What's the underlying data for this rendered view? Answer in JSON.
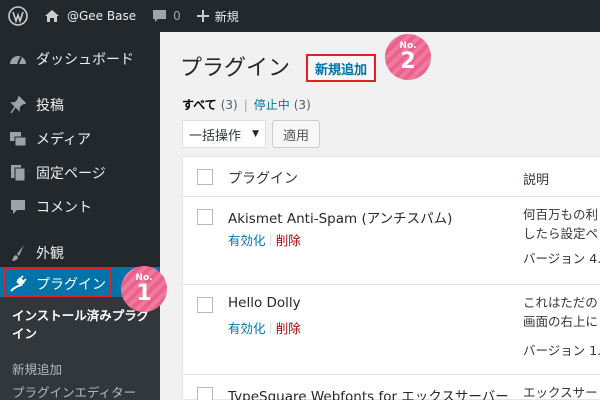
{
  "admin_bar": {
    "site_name": "@Gee Base",
    "comment_count": "0",
    "new_label": "新規"
  },
  "sidebar": {
    "items": [
      {
        "label": "ダッシュボード",
        "icon": "dashboard-icon"
      },
      {
        "label": "投稿",
        "icon": "pin-icon"
      },
      {
        "label": "メディア",
        "icon": "media-icon"
      },
      {
        "label": "固定ページ",
        "icon": "page-icon"
      },
      {
        "label": "コメント",
        "icon": "comment-icon"
      },
      {
        "label": "外観",
        "icon": "brush-icon"
      },
      {
        "label": "プラグイン",
        "icon": "plugin-icon"
      }
    ],
    "submenu": [
      {
        "label": "インストール済みプラグイン"
      },
      {
        "label": "新規追加"
      },
      {
        "label": "プラグインエディター"
      }
    ]
  },
  "badges": [
    {
      "no": "No.",
      "num": "1"
    },
    {
      "no": "No.",
      "num": "2"
    }
  ],
  "main": {
    "title": "プラグイン",
    "add_new": "新規追加",
    "filters": {
      "all_label": "すべて",
      "all_count": "(3)",
      "inactive_label": "停止中",
      "inactive_count": "(3)"
    },
    "bulk_action": "一括操作",
    "apply_label": "適用",
    "columns": {
      "name": "プラグイン",
      "description": "説明"
    },
    "plugins": [
      {
        "name": "Akismet Anti-Spam (アンチスパム)",
        "activate": "有効化",
        "delete": "削除",
        "desc1": "何百万もの利",
        "desc2": "したら設定ペ",
        "version": "バージョン 4."
      },
      {
        "name": "Hello Dolly",
        "activate": "有効化",
        "delete": "削除",
        "desc1": "これはただの",
        "desc2": "画面の右上に",
        "version": "バージョン 1."
      },
      {
        "name": "TypeSquare Webfonts for エックスサーバー",
        "desc1": "エックスサー"
      }
    ]
  },
  "colors": {
    "admin_bg": "#23282d",
    "accent": "#0073aa",
    "highlight_border": "#e31e24",
    "badge_pink": "#ef709a",
    "delete_red": "#aa0000"
  }
}
